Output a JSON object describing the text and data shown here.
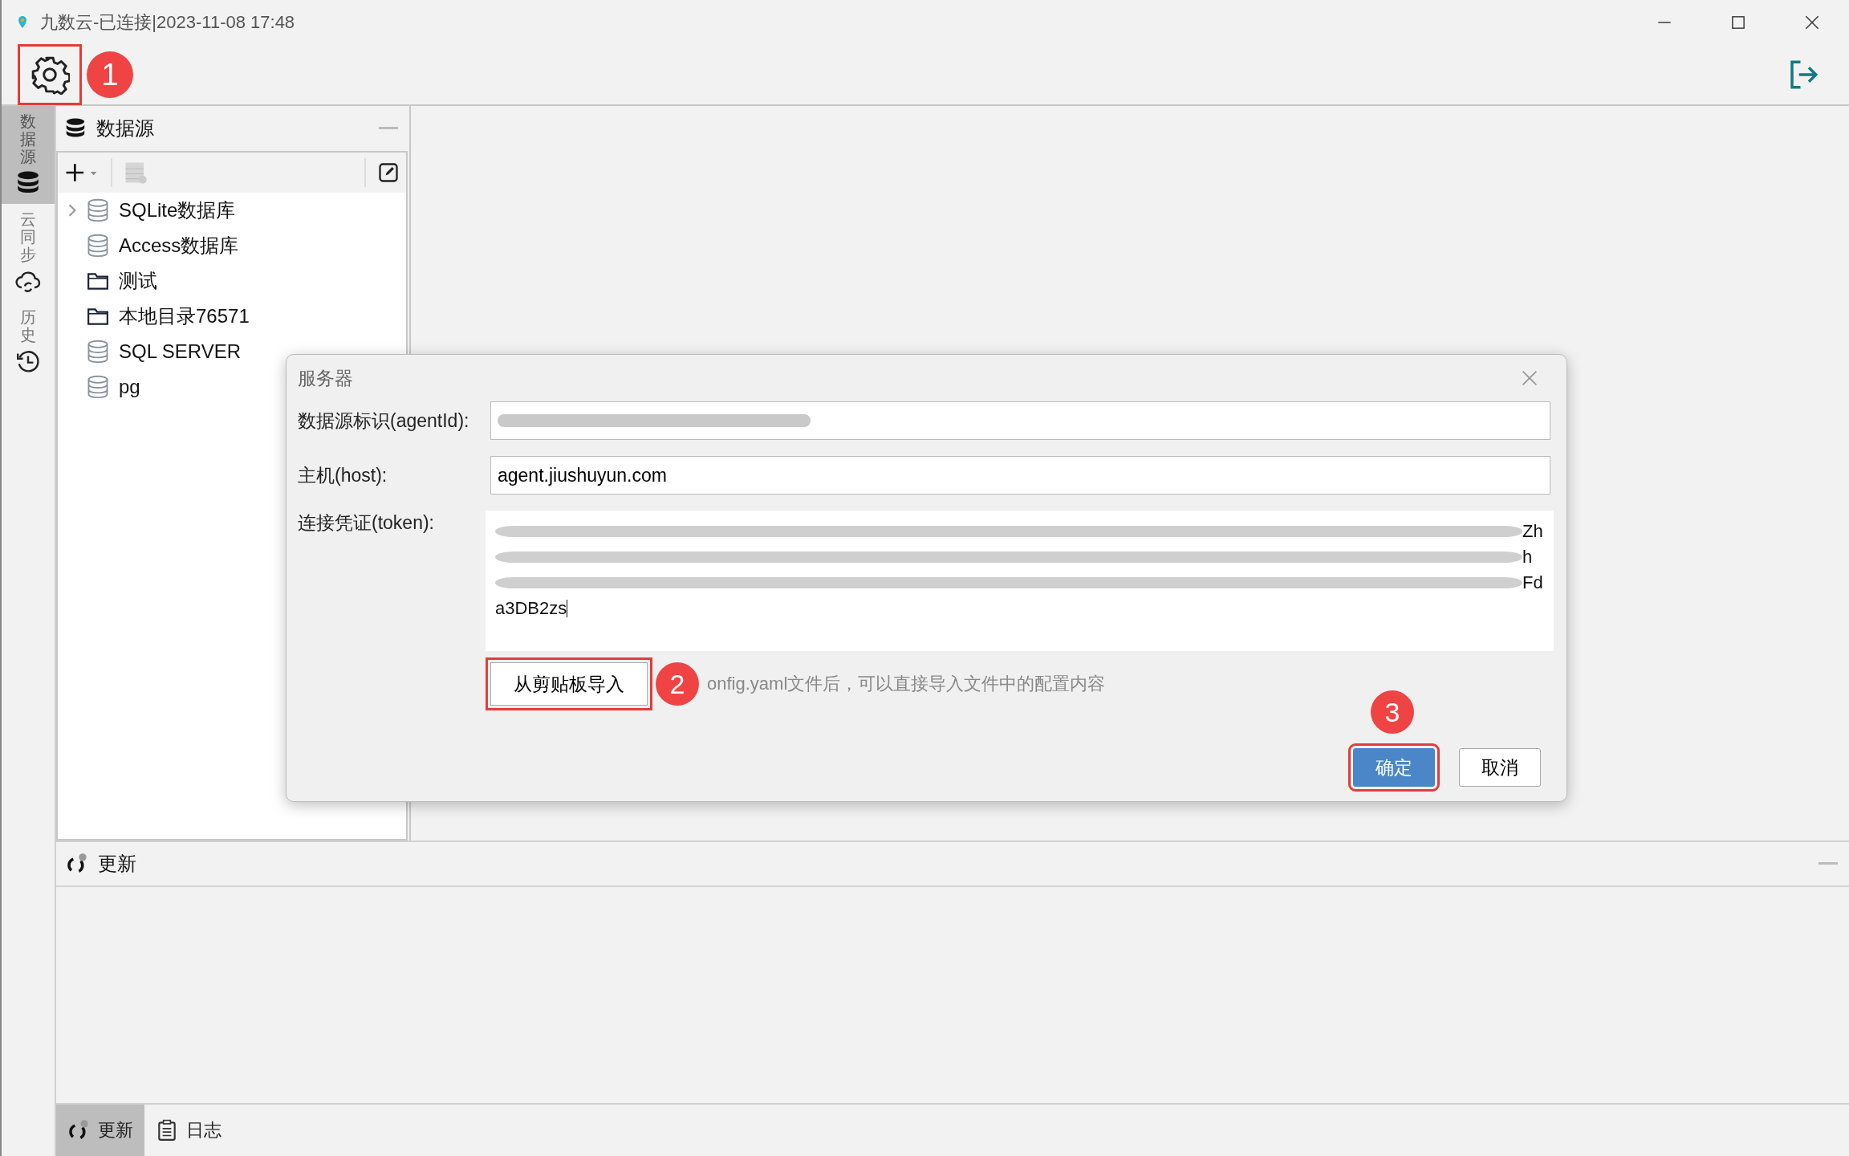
{
  "window": {
    "title": "九数云-已连接|2023-11-08 17:48"
  },
  "toolbar": {
    "settings_callout": "1"
  },
  "rail_tabs": [
    {
      "label": "数据源",
      "selected": true
    },
    {
      "label": "云同步",
      "selected": false
    },
    {
      "label": "历史",
      "selected": false
    }
  ],
  "datasource_panel": {
    "title": "数据源",
    "items": [
      {
        "label": "SQLite数据库",
        "kind": "database",
        "expandable": true
      },
      {
        "label": "Access数据库",
        "kind": "database",
        "expandable": false
      },
      {
        "label": "测试",
        "kind": "folder",
        "expandable": false
      },
      {
        "label": "本地目录76571",
        "kind": "folder",
        "expandable": false
      },
      {
        "label": "SQL SERVER",
        "kind": "database",
        "expandable": false
      },
      {
        "label": "pg",
        "kind": "database",
        "expandable": false
      }
    ]
  },
  "update_panel": {
    "title": "更新"
  },
  "bottom_tabs": [
    {
      "label": "更新",
      "selected": true
    },
    {
      "label": "日志",
      "selected": false
    }
  ],
  "dialog": {
    "title": "服务器",
    "fields": [
      {
        "label": "数据源标识(agentId):",
        "kind": "redacted"
      },
      {
        "label": "主机(host):",
        "kind": "text",
        "value": "agent.jiushuyun.com"
      }
    ],
    "token": {
      "label": "连接凭证(token):",
      "line_ends": [
        "Zh",
        "h",
        "Fd"
      ],
      "last_line": "a3DB2zs"
    },
    "import_button": {
      "label": "从剪贴板导入",
      "callout": "2"
    },
    "hint": "onfig.yaml文件后，可以直接导入文件中的配置内容",
    "buttons": [
      {
        "label": "确定",
        "kind": "primary",
        "callout": "3"
      },
      {
        "label": "取消",
        "kind": "default"
      }
    ]
  }
}
